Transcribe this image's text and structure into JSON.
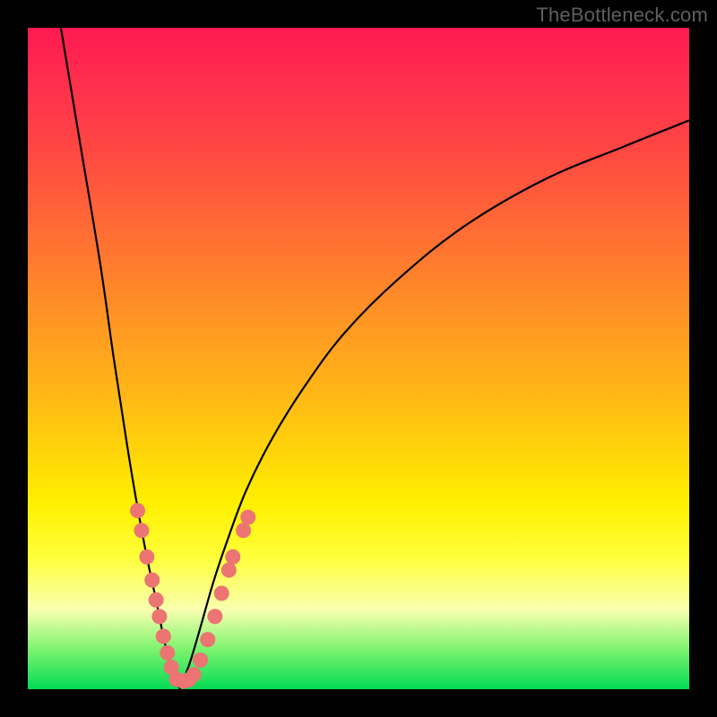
{
  "watermark": "TheBottleneck.com",
  "colors": {
    "dot": "#ec7472",
    "curve": "#000000",
    "frame": "#000000"
  },
  "chart_data": {
    "type": "line",
    "title": "",
    "xlabel": "",
    "ylabel": "",
    "xlim": [
      0,
      100
    ],
    "ylim": [
      0,
      100
    ],
    "note": "Axes unlabeled in source. x and y are normalized 0–100 percent of plot area (x left→right, y bottom→top). Two asymmetric curves meeting near x≈22, y≈0.",
    "series": [
      {
        "name": "left-curve",
        "x": [
          5,
          8,
          11,
          13,
          15,
          16.5,
          18,
          19.5,
          20.5,
          21.5,
          23
        ],
        "y": [
          100,
          82,
          64,
          50,
          37,
          28,
          20,
          13,
          8,
          4,
          0
        ]
      },
      {
        "name": "right-curve",
        "x": [
          23,
          24.5,
          26,
          28,
          30,
          33,
          37,
          42,
          48,
          56,
          66,
          78,
          90,
          100
        ],
        "y": [
          0,
          4,
          9,
          16,
          22,
          30,
          38,
          46,
          54,
          62,
          70,
          77,
          82,
          86
        ]
      }
    ],
    "scatter_overlay": {
      "name": "highlighted-points",
      "points": [
        {
          "x": 16.6,
          "y": 27
        },
        {
          "x": 17.2,
          "y": 24
        },
        {
          "x": 18.0,
          "y": 20
        },
        {
          "x": 18.8,
          "y": 16.5
        },
        {
          "x": 19.4,
          "y": 13.5
        },
        {
          "x": 19.9,
          "y": 11
        },
        {
          "x": 20.5,
          "y": 8
        },
        {
          "x": 21.1,
          "y": 5.5
        },
        {
          "x": 21.7,
          "y": 3.3
        },
        {
          "x": 22.5,
          "y": 1.5
        },
        {
          "x": 23.5,
          "y": 1.2
        },
        {
          "x": 24.3,
          "y": 1.4
        },
        {
          "x": 25.1,
          "y": 2.2
        },
        {
          "x": 26.1,
          "y": 4.4
        },
        {
          "x": 27.2,
          "y": 7.5
        },
        {
          "x": 28.3,
          "y": 11
        },
        {
          "x": 29.3,
          "y": 14.5
        },
        {
          "x": 30.4,
          "y": 18
        },
        {
          "x": 31.0,
          "y": 20
        },
        {
          "x": 32.6,
          "y": 24
        },
        {
          "x": 33.3,
          "y": 26
        }
      ]
    }
  }
}
